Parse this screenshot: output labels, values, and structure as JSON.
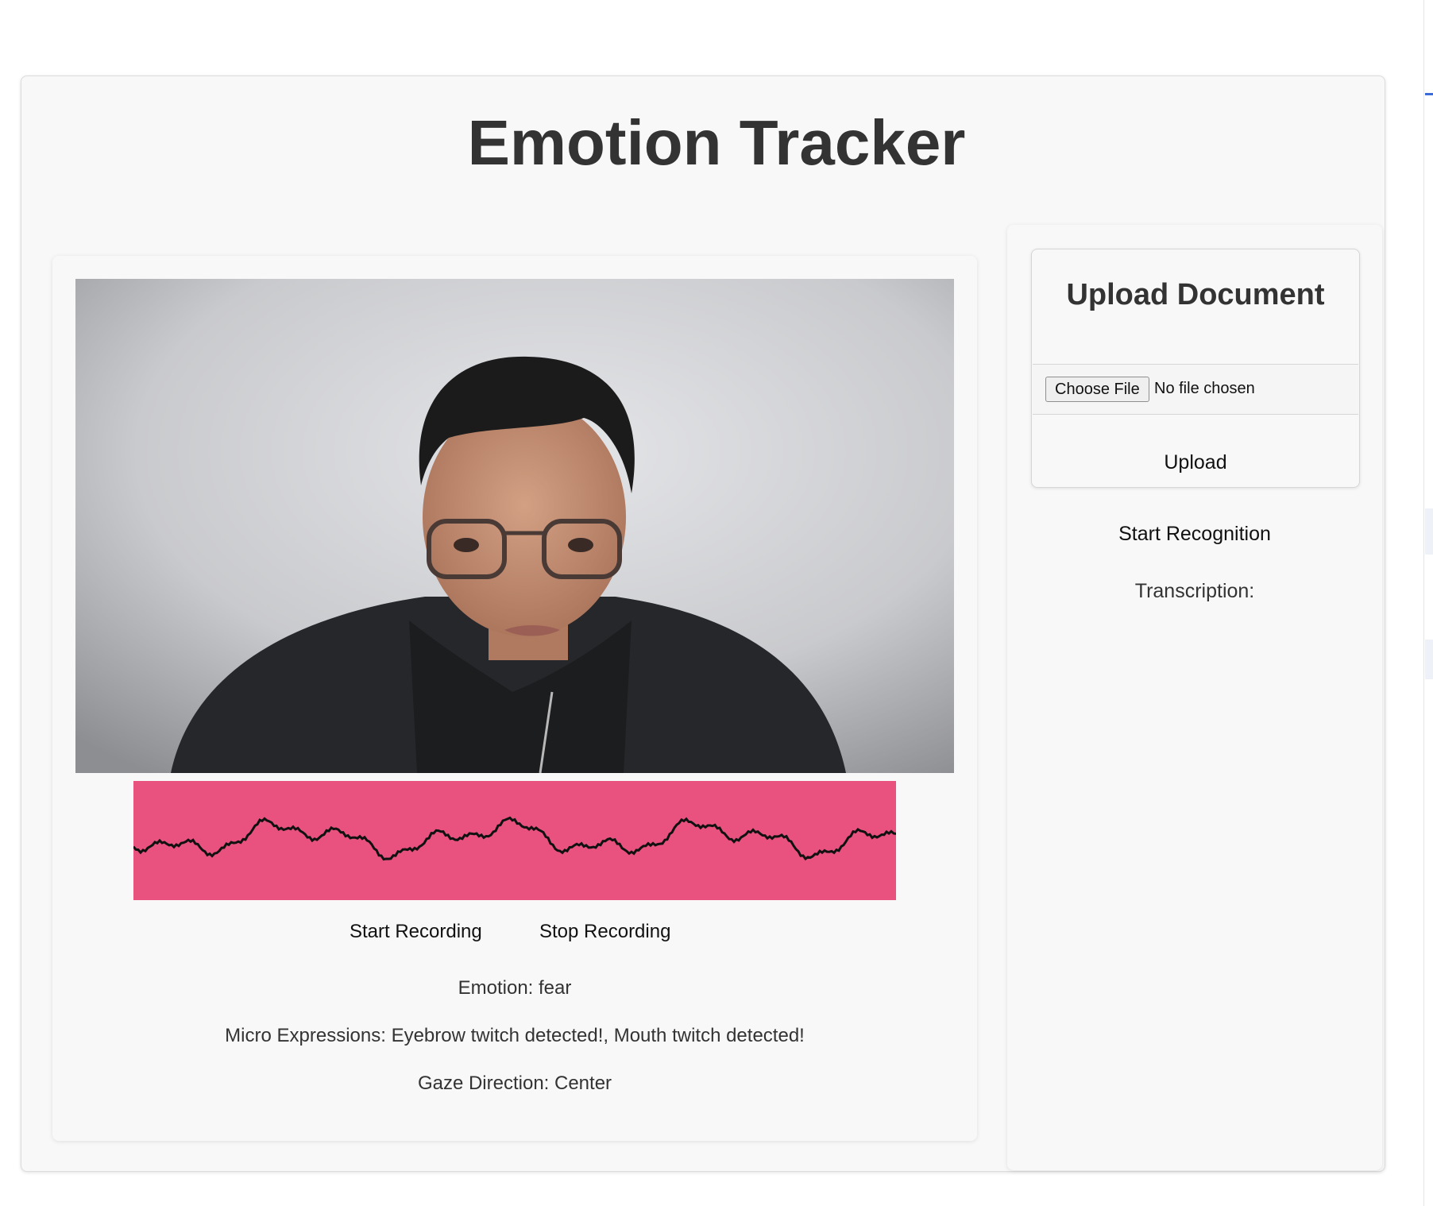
{
  "app": {
    "title": "Emotion Tracker"
  },
  "recorder": {
    "start_label": "Start Recording",
    "stop_label": "Stop Recording"
  },
  "analysis": {
    "emotion": "Emotion: fear",
    "micro_expressions": "Micro Expressions: Eyebrow twitch detected!, Mouth twitch detected!",
    "gaze": "Gaze Direction: Center"
  },
  "upload": {
    "title": "Upload Document",
    "choose_label": "Choose File",
    "file_status": "No file chosen",
    "upload_label": "Upload"
  },
  "speech": {
    "start_label": "Start Recognition",
    "transcription_label": "Transcription:"
  },
  "colors": {
    "waveform_bg": "#e9527e",
    "waveform_line": "#111111",
    "page_bg": "#f8f8f8"
  }
}
